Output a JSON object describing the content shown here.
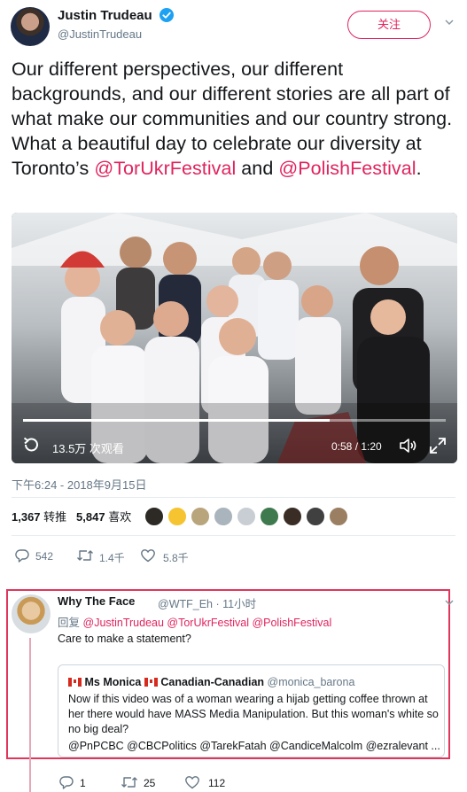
{
  "tweet": {
    "author_name": "Justin Trudeau",
    "author_handle": "@JustinTrudeau",
    "follow_label": "关注",
    "text_before": "Our different perspectives, our different backgrounds, and our different stories are all part of what make our communities and our country strong. What a beautiful day to celebrate our diversity at Toronto’s ",
    "mention_1": "@TorUkrFestival",
    "text_and": " and ",
    "mention_2": "@PolishFestival",
    "text_end": ".",
    "timestamp": "下午6:24 - 2018年9月15日"
  },
  "video": {
    "views": "13.5万 次观看",
    "time": "0:58 / 1:20",
    "progress": 0.725,
    "icons": [
      "replay-icon",
      "volume-icon",
      "fullscreen-icon"
    ]
  },
  "stats": {
    "retweets_count": "1,367",
    "retweets_label": "转推",
    "likes_count": "5,847",
    "likes_label": "喜欢",
    "liker_colors": [
      "#2d2a26",
      "#f5c430",
      "#b9a57c",
      "#aab4bd",
      "#c8ced3",
      "#3f7a4e",
      "#3a2d26",
      "#404040",
      "#9a7f63"
    ]
  },
  "actions": {
    "reply_count": "542",
    "retweet_count": "1.4千",
    "like_count": "5.8千"
  },
  "reply": {
    "name": "Why The Face",
    "handle_time": "@WTF_Eh · 11小时",
    "replying_label": "回复",
    "replying_mentions": "@JustinTrudeau @TorUkrFestival @PolishFestival",
    "text": "Care to make a statement?",
    "quote": {
      "name_a": "Ms Monica",
      "name_b": "Canadian-Canadian",
      "handle": "@monica_barona",
      "body": "Now if this video was of a woman wearing a hijab getting coffee thrown at her there would have MASS Media Manipulation. But this woman's white so no big deal?",
      "mentions": "@PnPCBC @CBCPolitics @TarekFatah @CandiceMalcolm @ezralevant ..."
    },
    "reply_count": "1",
    "retweet_count": "25",
    "like_count": "112"
  },
  "colors": {
    "accent": "#e0245e",
    "highlight_border": "#e0365b",
    "verified": "#1da1f2",
    "muted": "#657786"
  }
}
